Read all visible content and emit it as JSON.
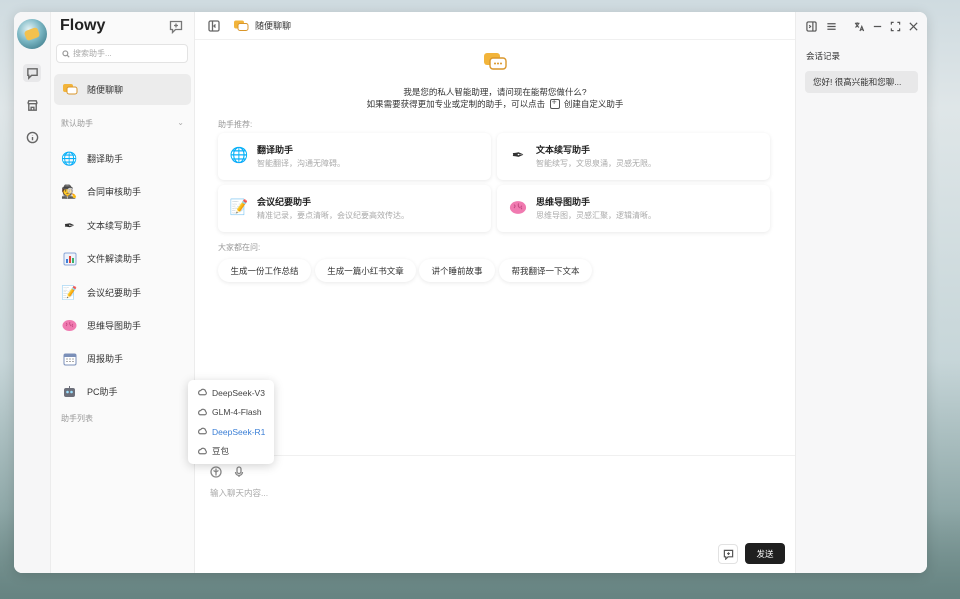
{
  "app": {
    "name": "Flowy"
  },
  "sidebar": {
    "search_placeholder": "搜索助手...",
    "active_item": "随便聊聊",
    "section_default": "默认助手",
    "section_list": "助手列表",
    "items": [
      {
        "label": "翻译助手",
        "icon": "globe-icon"
      },
      {
        "label": "合同审核助手",
        "icon": "detective-icon"
      },
      {
        "label": "文本续写助手",
        "icon": "pen-icon"
      },
      {
        "label": "文件解读助手",
        "icon": "bar-chart-icon"
      },
      {
        "label": "会议纪要助手",
        "icon": "memo-icon"
      },
      {
        "label": "思维导图助手",
        "icon": "brain-icon"
      },
      {
        "label": "周报助手",
        "icon": "calendar-icon"
      },
      {
        "label": "PC助手",
        "icon": "robot-icon"
      }
    ]
  },
  "model_menu": {
    "options": [
      "DeepSeek-V3",
      "GLM-4-Flash",
      "DeepSeek-R1",
      "豆包"
    ],
    "selected": "DeepSeek-R1",
    "selected_color": "#3b7fd6"
  },
  "chat": {
    "title": "随便聊聊",
    "welcome_line1": "我是您的私人智能助理，请问现在能帮您做什么?",
    "welcome_line2_prefix": "如果需要获得更加专业或定制的助手，可以点击",
    "welcome_line2_suffix": "创建自定义助手",
    "recommend_label": "助手推荐:",
    "cards": [
      {
        "title": "翻译助手",
        "desc": "智能翻译，沟通无障碍。",
        "icon": "globe-icon"
      },
      {
        "title": "文本续写助手",
        "desc": "智能续写，文思泉涌，灵感无限。",
        "icon": "pen-icon"
      },
      {
        "title": "会议纪要助手",
        "desc": "精准记录，要点清晰，会议纪要高效传达。",
        "icon": "memo-icon"
      },
      {
        "title": "思维导图助手",
        "desc": "思维导图，灵感汇聚，逻辑清晰。",
        "icon": "brain-icon"
      }
    ],
    "faq_label": "大家都在问:",
    "chips": [
      "生成一份工作总结",
      "生成一篇小红书文章",
      "讲个睡前故事",
      "帮我翻译一下文本"
    ],
    "input_placeholder": "输入聊天内容...",
    "send_label": "发送"
  },
  "history": {
    "title": "会话记录",
    "items": [
      "您好! 很高兴能和您聊..."
    ]
  },
  "colors": {
    "accent": "#f2b43a",
    "send_bg": "#1f1f1f"
  }
}
